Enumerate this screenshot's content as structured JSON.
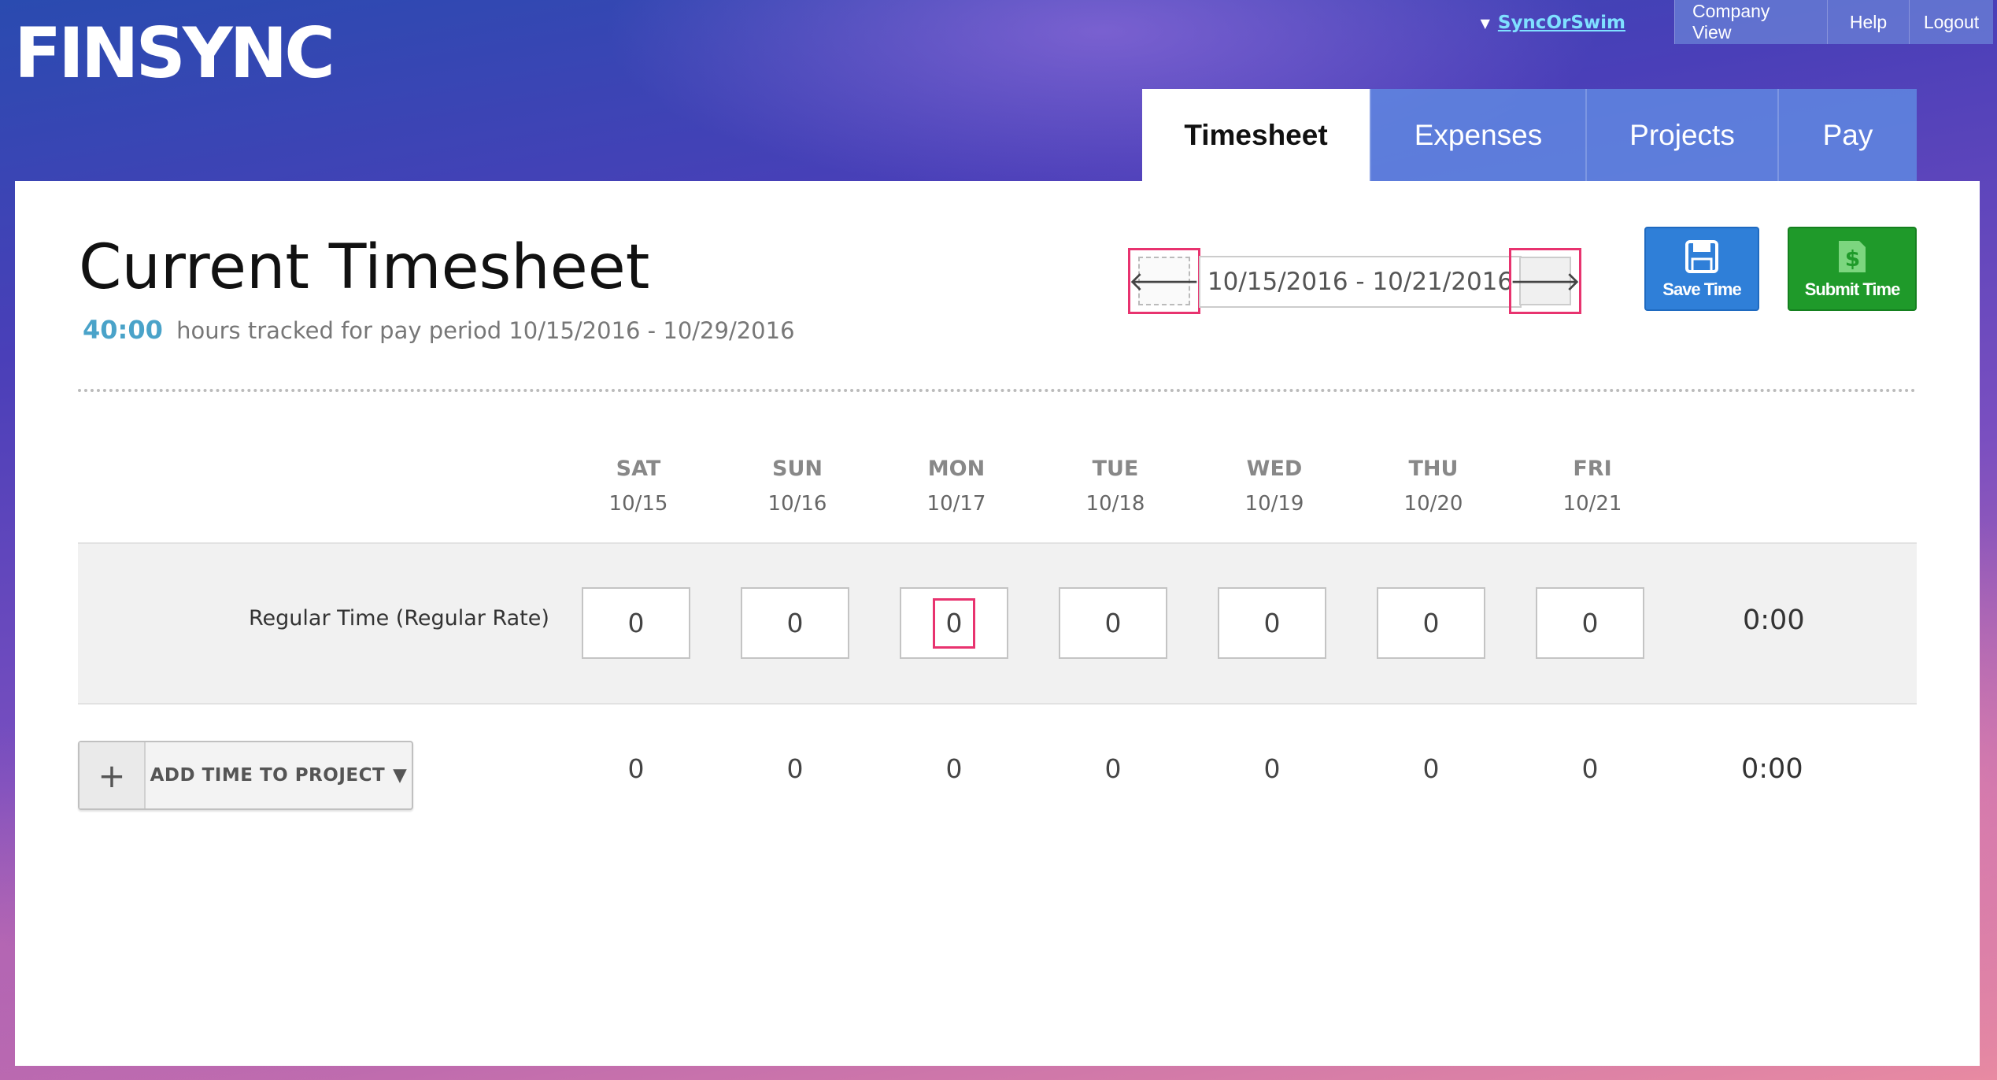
{
  "app": {
    "logo": "FINSYNC"
  },
  "top_nav": {
    "caret": "▼",
    "user": "SyncOrSwim",
    "company_view": "Company View",
    "help": "Help",
    "logout": "Logout"
  },
  "tabs": [
    {
      "label": "Timesheet",
      "active": true
    },
    {
      "label": "Expenses",
      "active": false
    },
    {
      "label": "Projects",
      "active": false
    },
    {
      "label": "Pay",
      "active": false
    }
  ],
  "page": {
    "title": "Current Timesheet",
    "hours": "40:00",
    "hours_text": "hours tracked for pay period 10/15/2016 - 10/29/2016"
  },
  "date_nav": {
    "prev_icon": "arrow-left-icon",
    "next_icon": "arrow-right-icon",
    "prev_glyph": "🡐",
    "next_glyph": "🡒",
    "range": "10/15/2016 - 10/21/2016"
  },
  "actions": {
    "save_label": "Save Time",
    "submit_label": "Submit Time",
    "save_color": "#2f7fd8",
    "submit_color": "#1f9a2a"
  },
  "days": [
    {
      "name": "SAT",
      "date": "10/15"
    },
    {
      "name": "SUN",
      "date": "10/16"
    },
    {
      "name": "MON",
      "date": "10/17"
    },
    {
      "name": "TUE",
      "date": "10/18"
    },
    {
      "name": "WED",
      "date": "10/19"
    },
    {
      "name": "THU",
      "date": "10/20"
    },
    {
      "name": "FRI",
      "date": "10/21"
    }
  ],
  "rows": [
    {
      "label": "Regular Time (Regular Rate)",
      "values": [
        "0",
        "0",
        "0",
        "0",
        "0",
        "0",
        "0"
      ],
      "total": "0:00"
    }
  ],
  "totals": {
    "values": [
      "0",
      "0",
      "0",
      "0",
      "0",
      "0",
      "0"
    ],
    "total": "0:00"
  },
  "add_project": {
    "plus": "+",
    "label": "ADD TIME TO PROJECT",
    "caret": "▼"
  }
}
